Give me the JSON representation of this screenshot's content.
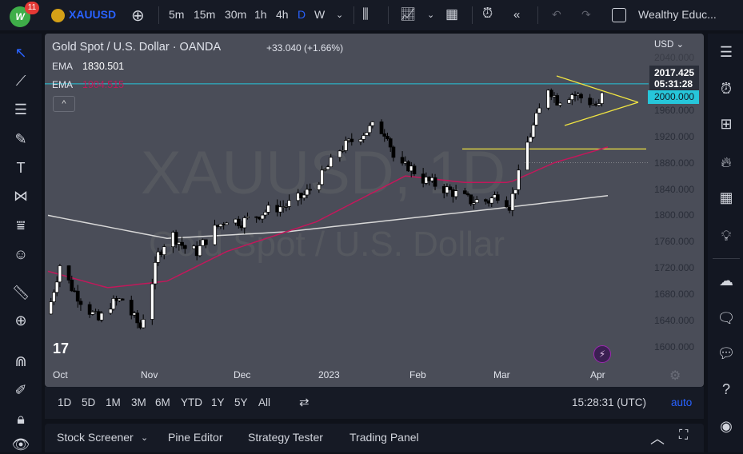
{
  "topbar": {
    "notifications": "11",
    "logo_text": "W",
    "symbol": "XAUUSD",
    "intervals": [
      "5m",
      "15m",
      "30m",
      "1h",
      "4h",
      "D",
      "W"
    ],
    "active_interval": "D",
    "layout_name": "Wealthy Educ..."
  },
  "legend": {
    "title": "Gold Spot / U.S. Dollar · OANDA",
    "change": "+33.040 (+1.66%)",
    "ema1_label": "EMA",
    "ema1_value": "1830.501",
    "ema2_label": "EMA",
    "ema2_value": "1904.515"
  },
  "watermark": {
    "symbol": "XAUUSD, 1D",
    "name": "Gold Spot / U.S. Dollar"
  },
  "price_axis": {
    "currency": "USD",
    "ticks": [
      "2040.000",
      "1960.000",
      "1920.000",
      "1880.000",
      "1840.000",
      "1800.000",
      "1760.000",
      "1720.000",
      "1680.000",
      "1640.000",
      "1600.000"
    ],
    "last_price": "2017.425",
    "countdown": "05:31:28",
    "line_price": "2000.000"
  },
  "time_axis": [
    "Oct",
    "Nov",
    "Dec",
    "2023",
    "Feb",
    "Mar",
    "Apr"
  ],
  "timeframes": [
    "1D",
    "5D",
    "1M",
    "3M",
    "6M",
    "YTD",
    "1Y",
    "5Y",
    "All"
  ],
  "clock": "15:28:31 (UTC)",
  "auto_label": "auto",
  "bottom_tabs": [
    "Stock Screener",
    "Pine Editor",
    "Strategy Tester",
    "Trading Panel"
  ],
  "colors": {
    "accent": "#2962ff",
    "cyan": "#26c6da",
    "ema_red": "#c2185b",
    "ema_white": "#d8d8d8",
    "trend": "#f0e442"
  },
  "chart_data": {
    "type": "candlestick",
    "price_range": [
      1580,
      2060
    ],
    "days": 134,
    "close_path": [
      [
        0,
        1650
      ],
      [
        4,
        1725
      ],
      [
        8,
        1690
      ],
      [
        12,
        1665
      ],
      [
        17,
        1640
      ],
      [
        21,
        1665
      ],
      [
        25,
        1672
      ],
      [
        28,
        1650
      ],
      [
        31,
        1630
      ],
      [
        34,
        1680
      ],
      [
        37,
        1740
      ],
      [
        41,
        1775
      ],
      [
        46,
        1750
      ],
      [
        50,
        1745
      ],
      [
        55,
        1775
      ],
      [
        60,
        1795
      ],
      [
        65,
        1790
      ],
      [
        70,
        1800
      ],
      [
        75,
        1810
      ],
      [
        80,
        1815
      ],
      [
        86,
        1830
      ],
      [
        92,
        1860
      ],
      [
        98,
        1900
      ],
      [
        104,
        1920
      ],
      [
        109,
        1935
      ],
      [
        114,
        1925
      ],
      [
        117,
        1870
      ],
      [
        121,
        1875
      ],
      [
        126,
        1855
      ],
      [
        131,
        1845
      ],
      [
        136,
        1835
      ],
      [
        142,
        1822
      ],
      [
        148,
        1822
      ],
      [
        152,
        1835
      ],
      [
        155,
        1815
      ],
      [
        158,
        1860
      ],
      [
        161,
        1910
      ],
      [
        165,
        1960
      ],
      [
        168,
        1995
      ],
      [
        171,
        1975
      ],
      [
        176,
        1985
      ],
      [
        181,
        1975
      ],
      [
        185,
        1965
      ],
      [
        188,
        2017
      ]
    ],
    "ema_200": [
      [
        0,
        1800
      ],
      [
        40,
        1765
      ],
      [
        80,
        1775
      ],
      [
        120,
        1795
      ],
      [
        150,
        1810
      ],
      [
        188,
        1830
      ]
    ],
    "ema_50": [
      [
        0,
        1715
      ],
      [
        20,
        1690
      ],
      [
        40,
        1700
      ],
      [
        60,
        1745
      ],
      [
        90,
        1790
      ],
      [
        120,
        1860
      ],
      [
        140,
        1850
      ],
      [
        155,
        1850
      ],
      [
        170,
        1880
      ],
      [
        188,
        1904
      ]
    ],
    "horizontal_levels": [
      2000,
      1901
    ]
  }
}
